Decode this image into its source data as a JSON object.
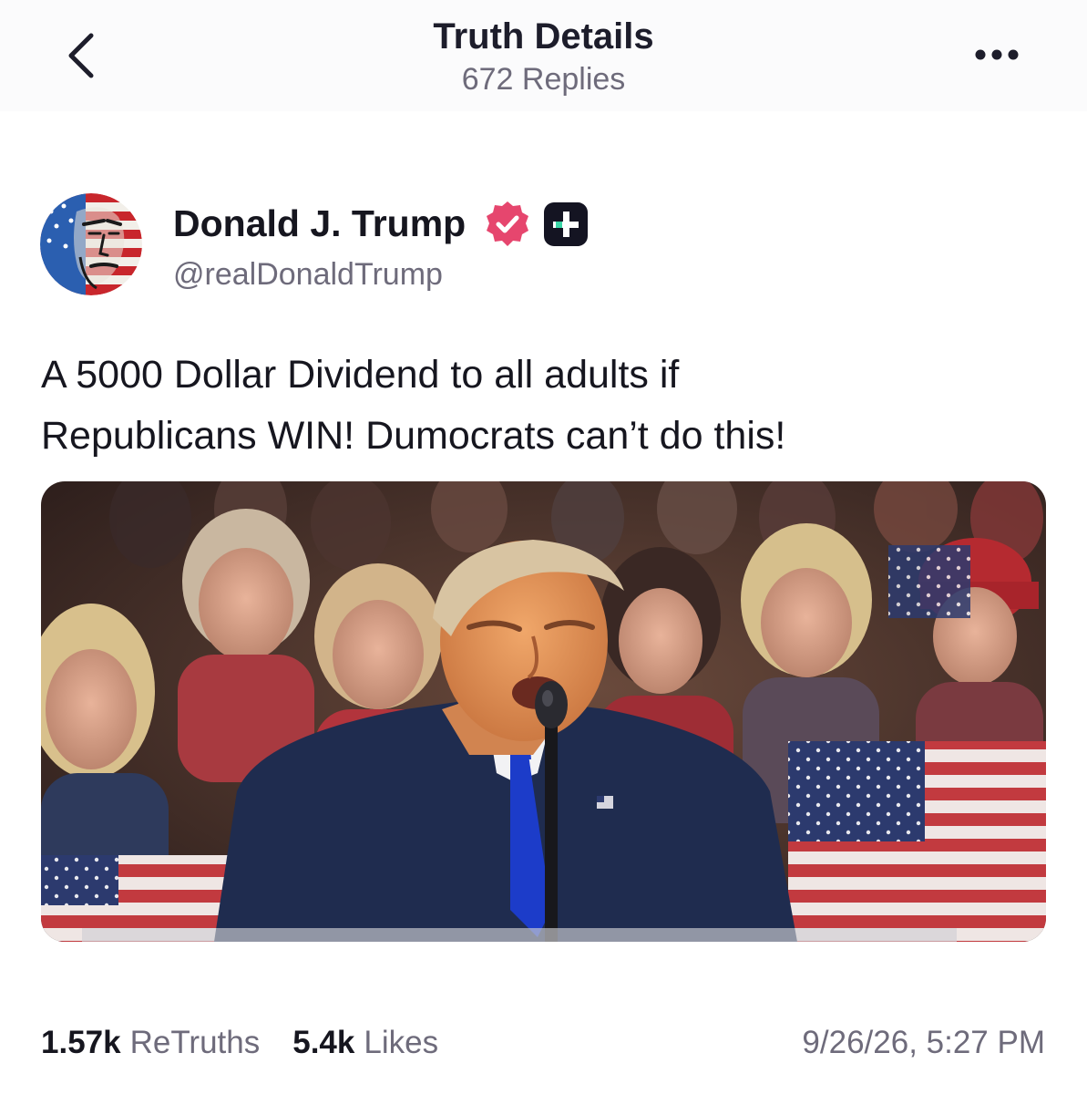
{
  "header": {
    "title": "Truth Details",
    "subtitle": "672 Replies",
    "back_icon": "chevron-left-icon",
    "more_icon": "more-horizontal-icon"
  },
  "author": {
    "name": "Donald J. Trump",
    "handle": "@realDonaldTrump",
    "verified_icon": "verified-badge-icon",
    "verified_color": "#e6466e",
    "plus_icon": "truth-plus-icon"
  },
  "post": {
    "text_lines": [
      "A 5000 Dollar Dividend to all adults if",
      "Republicans WIN! Dumocrats can’t do this!"
    ],
    "media_type": "rally-photo"
  },
  "stats": {
    "retruths_count": "1.57k",
    "retruths_label": "ReTruths",
    "likes_count": "5.4k",
    "likes_label": "Likes",
    "timestamp": "9/26/26, 5:27 PM"
  },
  "colors": {
    "text_primary": "#16161f",
    "text_secondary": "#6e6b7b",
    "header_bg": "#fbfbfc"
  }
}
